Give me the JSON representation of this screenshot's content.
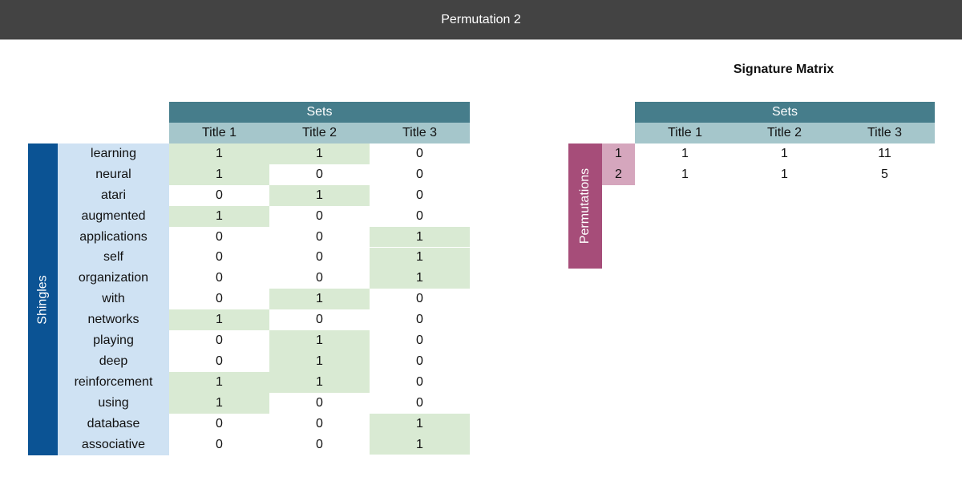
{
  "header": {
    "title": "Permutation 2"
  },
  "colors": {
    "topbar": "#434343",
    "sets_header": "#467d8b",
    "column_header": "#a5c6cb",
    "highlight": "#d9ead3",
    "shingles_axis": "#0b5394",
    "shingle_label": "#cfe2f3",
    "permutations_axis": "#a64d79",
    "permutation_label": "#d5a6bd"
  },
  "input_matrix": {
    "sets_label": "Sets",
    "row_axis_label": "Shingles",
    "columns": [
      "Title 1",
      "Title 2",
      "Title 3"
    ],
    "rows": [
      {
        "label": "learning",
        "values": [
          1,
          1,
          0
        ]
      },
      {
        "label": "neural",
        "values": [
          1,
          0,
          0
        ]
      },
      {
        "label": "atari",
        "values": [
          0,
          1,
          0
        ]
      },
      {
        "label": "augmented",
        "values": [
          1,
          0,
          0
        ]
      },
      {
        "label": "applications",
        "values": [
          0,
          0,
          1
        ]
      },
      {
        "label": "self",
        "values": [
          0,
          0,
          1
        ]
      },
      {
        "label": "organization",
        "values": [
          0,
          0,
          1
        ]
      },
      {
        "label": "with",
        "values": [
          0,
          1,
          0
        ]
      },
      {
        "label": "networks",
        "values": [
          1,
          0,
          0
        ]
      },
      {
        "label": "playing",
        "values": [
          0,
          1,
          0
        ]
      },
      {
        "label": "deep",
        "values": [
          0,
          1,
          0
        ]
      },
      {
        "label": "reinforcement",
        "values": [
          1,
          1,
          0
        ]
      },
      {
        "label": "using",
        "values": [
          1,
          0,
          0
        ]
      },
      {
        "label": "database",
        "values": [
          0,
          0,
          1
        ]
      },
      {
        "label": "associative",
        "values": [
          0,
          0,
          1
        ]
      }
    ]
  },
  "signature_matrix": {
    "title": "Signature Matrix",
    "sets_label": "Sets",
    "row_axis_label": "Permutations",
    "columns": [
      "Title 1",
      "Title 2",
      "Title 3"
    ],
    "rows": [
      {
        "label": "1",
        "values": [
          1,
          1,
          11
        ]
      },
      {
        "label": "2",
        "values": [
          1,
          1,
          5
        ]
      }
    ]
  }
}
